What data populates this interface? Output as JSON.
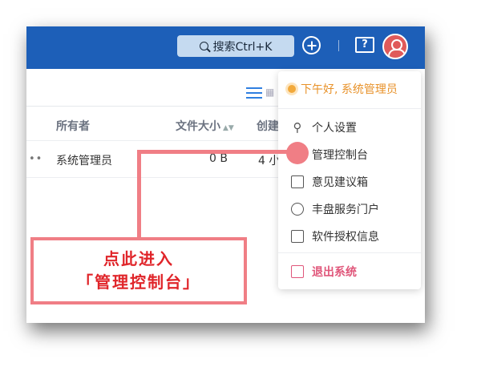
{
  "header": {
    "search_label": "搜索Ctrl+K",
    "help_glyph": "?"
  },
  "table": {
    "columns": [
      "所有者",
      "文件大小",
      "创建"
    ],
    "row": {
      "more": "••",
      "owner": "系统管理员",
      "size": "0 B",
      "created": "4 小"
    }
  },
  "user_menu": {
    "greeting": "下午好, 系统管理员",
    "items": [
      {
        "label": "个人设置",
        "icon": "sliders-icon"
      },
      {
        "label": "管理控制台",
        "icon": "console-icon"
      },
      {
        "label": "意见建议箱",
        "icon": "mailbox-icon"
      },
      {
        "label": "丰盘服务门户",
        "icon": "globe-icon"
      },
      {
        "label": "软件授权信息",
        "icon": "license-card-icon"
      }
    ],
    "logout": "退出系统"
  },
  "annotation": {
    "line1": "点此进入",
    "line2": "「管理控制台」",
    "color": "#f07e85",
    "text_color": "#e0252a"
  },
  "colors": {
    "topbar": "#1d5fb8",
    "avatar": "#e05a5a",
    "greeting": "#e8922a",
    "logout": "#e0567a"
  }
}
